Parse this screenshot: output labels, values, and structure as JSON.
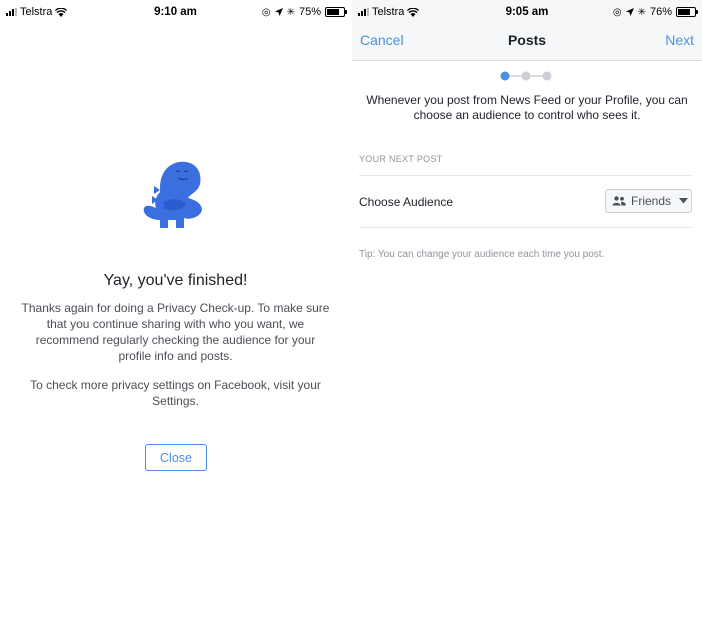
{
  "left_screen": {
    "status": {
      "carrier": "Telstra",
      "time": "9:10 am",
      "battery": "75%",
      "battery_level": 0.75
    },
    "title": "Yay, you've finished!",
    "body": "Thanks again for doing a Privacy Check-up. To make sure that you continue sharing with who you want, we recommend regularly checking the audience for your profile info and posts.",
    "body2": "To check more privacy settings on Facebook, visit your Settings.",
    "close_label": "Close"
  },
  "right_screen": {
    "status": {
      "carrier": "Telstra",
      "time": "9:05 am",
      "battery": "76%",
      "battery_level": 0.76
    },
    "nav": {
      "cancel": "Cancel",
      "title": "Posts",
      "next": "Next"
    },
    "progress": {
      "steps": 3,
      "current": 1
    },
    "description": "Whenever you post from News Feed or your Profile, you can choose an audience to control who sees it.",
    "section_header": "YOUR NEXT POST",
    "row_label": "Choose Audience",
    "audience_value": "Friends",
    "tip": "Tip: You can change your audience each time you post."
  },
  "colors": {
    "accent": "#4a90e2",
    "dino": "#3b6fe0"
  },
  "icons": {
    "wifi": "wifi-icon",
    "location": "location-arrow-icon",
    "bluetooth": "bluetooth-icon",
    "friends": "friends-icon",
    "dropdown": "caret-down-icon"
  }
}
